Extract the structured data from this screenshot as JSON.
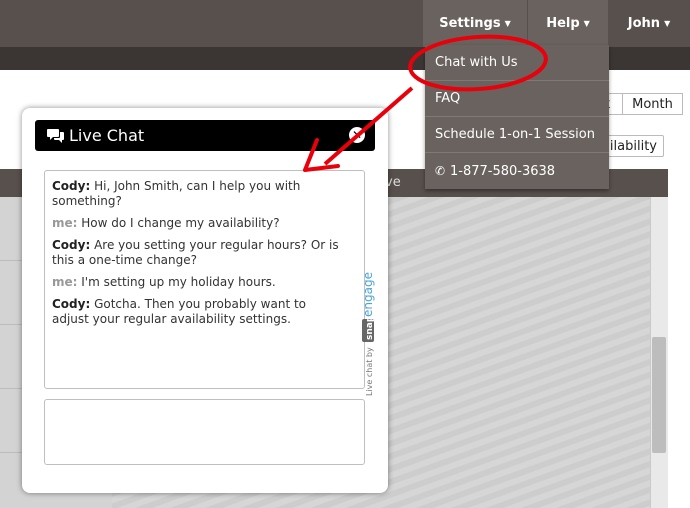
{
  "nav": {
    "settings_label": "Settings",
    "help_label": "Help",
    "user_label": "John"
  },
  "help_menu": {
    "items": [
      {
        "label": "Chat with Us"
      },
      {
        "label": "FAQ"
      },
      {
        "label": "Schedule 1-on-1 Session"
      },
      {
        "label": "1-877-580-3638",
        "icon": "phone-icon"
      }
    ]
  },
  "background": {
    "toggle_week": "k",
    "toggle_month": "Month",
    "availability_button": "ailability",
    "calendar_header": "ve"
  },
  "chat": {
    "title": "Live Chat",
    "messages": [
      {
        "sender": "Cody:",
        "text": " Hi, John Smith, can I help you with something?",
        "role": "agent"
      },
      {
        "sender": "me:",
        "text": " How do I change my availability?",
        "role": "me"
      },
      {
        "sender": "Cody:",
        "text": " Are you setting your regular hours? Or is this a one-time change?",
        "role": "agent"
      },
      {
        "sender": "me:",
        "text": " I'm setting up my holiday hours.",
        "role": "me"
      },
      {
        "sender": "Cody:",
        "text": " Gotcha. Then you probably want to adjust your regular availability settings.",
        "role": "agent"
      }
    ],
    "brand_prefix": "Live chat by",
    "brand_snap": "snap",
    "brand_engage": "engage"
  },
  "colors": {
    "topbar": "#58504c",
    "dropdown": "#6a625e",
    "annotation_red": "#e8000b",
    "brand_blue": "#4aa3d6"
  }
}
